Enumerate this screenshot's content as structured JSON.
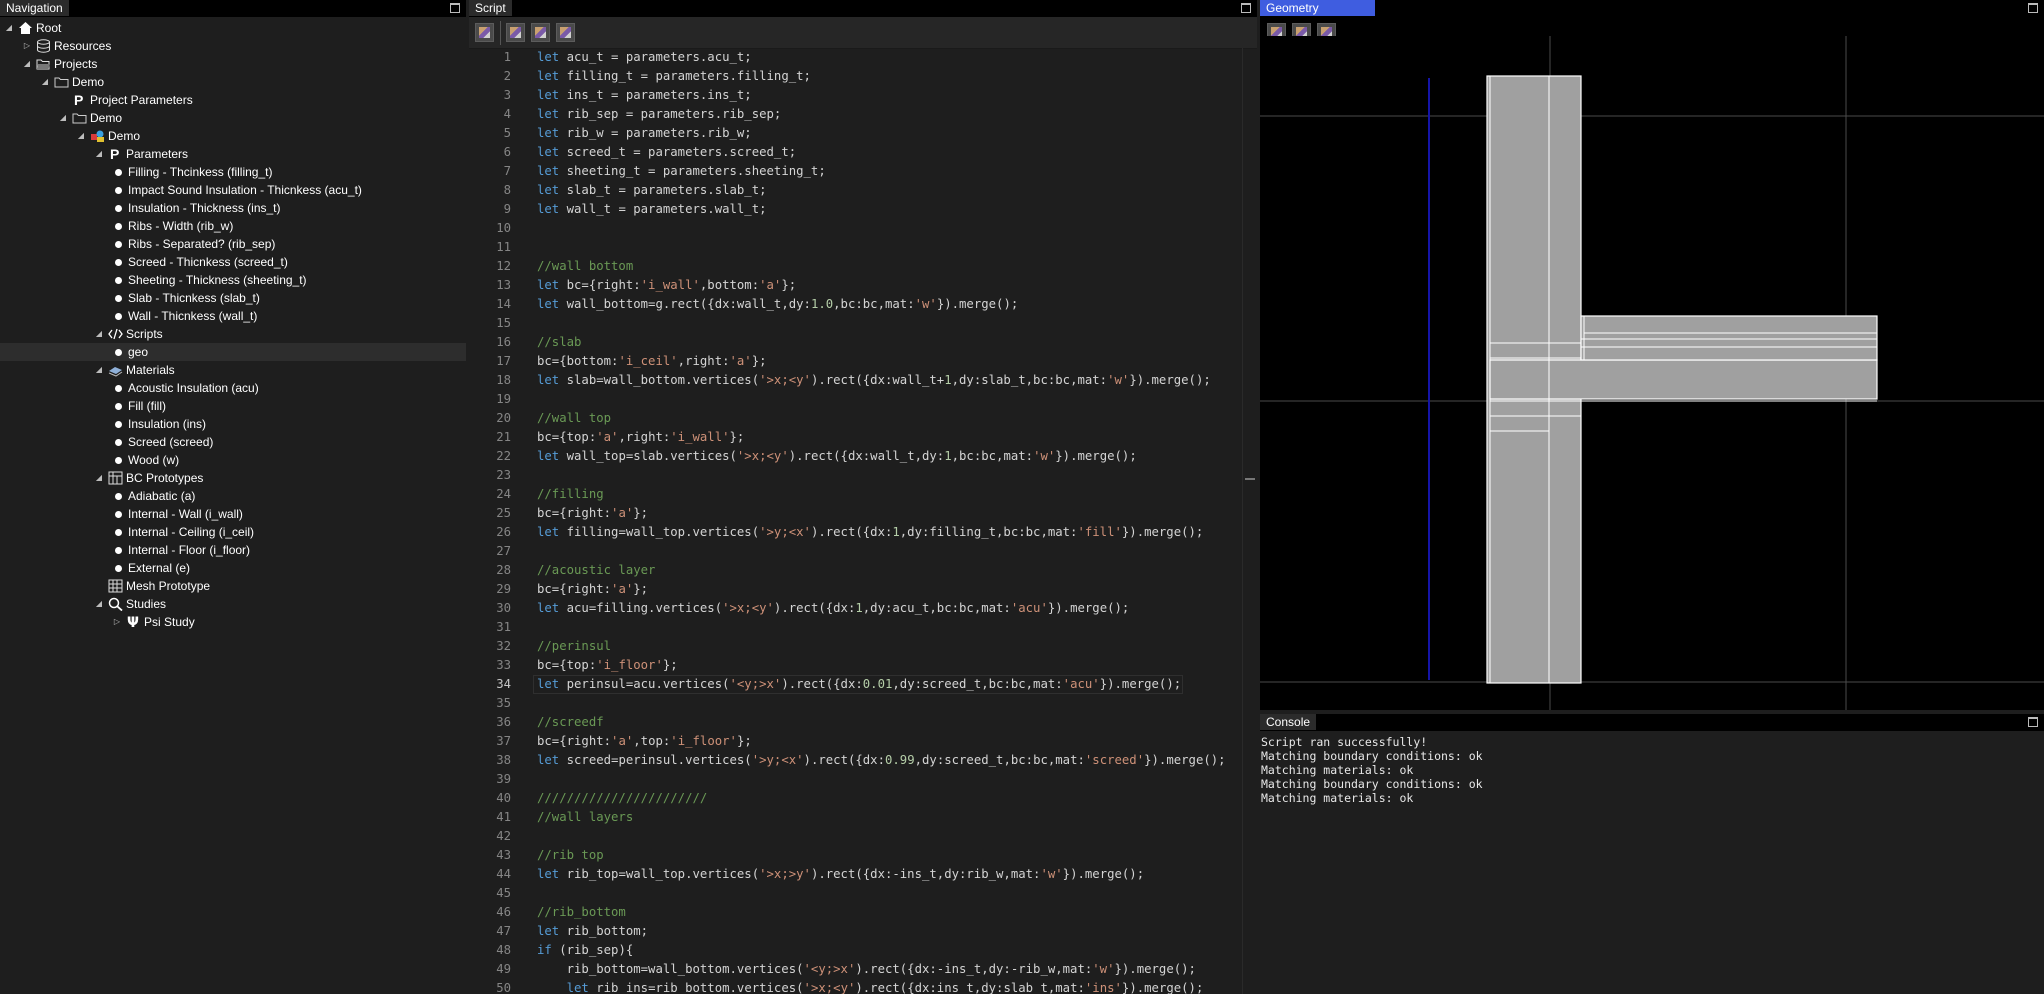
{
  "nav": {
    "title": "Navigation",
    "items": [
      {
        "label": "Root",
        "icon": "home-icon",
        "toggle": "expanded",
        "depth": 0
      },
      {
        "label": "Resources",
        "icon": "database-icon",
        "toggle": "collapsed",
        "depth": 1
      },
      {
        "label": "Projects",
        "icon": "folder-open-icon",
        "toggle": "expanded",
        "depth": 1
      },
      {
        "label": "Demo",
        "icon": "folder-icon",
        "toggle": "expanded",
        "depth": 2
      },
      {
        "label": "Project Parameters",
        "icon": "parameter-icon",
        "toggle": "none",
        "depth": 3
      },
      {
        "label": "Demo",
        "icon": "folder-icon",
        "toggle": "expanded",
        "depth": 3
      },
      {
        "label": "Demo",
        "icon": "model-icon",
        "toggle": "expanded",
        "depth": 4
      },
      {
        "label": "Parameters",
        "icon": "parameter-icon",
        "toggle": "expanded",
        "depth": 5
      },
      {
        "label": "Filling - Thcinkess (filling_t)",
        "icon": "dot",
        "toggle": "none",
        "depth": 6
      },
      {
        "label": "Impact Sound Insulation - Thicnkess (acu_t)",
        "icon": "dot",
        "toggle": "none",
        "depth": 6
      },
      {
        "label": "Insulation - Thickness (ins_t)",
        "icon": "dot",
        "toggle": "none",
        "depth": 6
      },
      {
        "label": "Ribs - Width (rib_w)",
        "icon": "dot",
        "toggle": "none",
        "depth": 6
      },
      {
        "label": "Ribs - Separated? (rib_sep)",
        "icon": "dot",
        "toggle": "none",
        "depth": 6
      },
      {
        "label": "Screed - Thicnkess (screed_t)",
        "icon": "dot",
        "toggle": "none",
        "depth": 6
      },
      {
        "label": "Sheeting - Thickness (sheeting_t)",
        "icon": "dot",
        "toggle": "none",
        "depth": 6
      },
      {
        "label": "Slab - Thicnkess (slab_t)",
        "icon": "dot",
        "toggle": "none",
        "depth": 6
      },
      {
        "label": "Wall - Thicnkess (wall_t)",
        "icon": "dot",
        "toggle": "none",
        "depth": 6
      },
      {
        "label": "Scripts",
        "icon": "code-icon",
        "toggle": "expanded",
        "depth": 5
      },
      {
        "label": "geo",
        "icon": "dot",
        "toggle": "none",
        "depth": 6,
        "selected": true
      },
      {
        "label": "Materials",
        "icon": "materials-icon",
        "toggle": "expanded",
        "depth": 5
      },
      {
        "label": "Acoustic Insulation (acu)",
        "icon": "dot",
        "toggle": "none",
        "depth": 6
      },
      {
        "label": "Fill (fill)",
        "icon": "dot",
        "toggle": "none",
        "depth": 6
      },
      {
        "label": "Insulation (ins)",
        "icon": "dot",
        "toggle": "none",
        "depth": 6
      },
      {
        "label": "Screed (screed)",
        "icon": "dot",
        "toggle": "none",
        "depth": 6
      },
      {
        "label": "Wood (w)",
        "icon": "dot",
        "toggle": "none",
        "depth": 6
      },
      {
        "label": "BC Prototypes",
        "icon": "bc-icon",
        "toggle": "expanded",
        "depth": 5
      },
      {
        "label": "Adiabatic (a)",
        "icon": "dot",
        "toggle": "none",
        "depth": 6
      },
      {
        "label": "Internal - Wall (i_wall)",
        "icon": "dot",
        "toggle": "none",
        "depth": 6
      },
      {
        "label": "Internal - Ceiling (i_ceil)",
        "icon": "dot",
        "toggle": "none",
        "depth": 6
      },
      {
        "label": "Internal - Floor (i_floor)",
        "icon": "dot",
        "toggle": "none",
        "depth": 6
      },
      {
        "label": "External (e)",
        "icon": "dot",
        "toggle": "none",
        "depth": 6
      },
      {
        "label": "Mesh Prototype",
        "icon": "mesh-icon",
        "toggle": "none",
        "depth": 5
      },
      {
        "label": "Studies",
        "icon": "search-icon",
        "toggle": "expanded",
        "depth": 5
      },
      {
        "label": "Psi Study",
        "icon": "psi-icon",
        "toggle": "collapsed",
        "depth": 6
      }
    ]
  },
  "script": {
    "title": "Script",
    "current_line": 34,
    "lines": [
      "let acu_t = parameters.acu_t;",
      "let filling_t = parameters.filling_t;",
      "let ins_t = parameters.ins_t;",
      "let rib_sep = parameters.rib_sep;",
      "let rib_w = parameters.rib_w;",
      "let screed_t = parameters.screed_t;",
      "let sheeting_t = parameters.sheeting_t;",
      "let slab_t = parameters.slab_t;",
      "let wall_t = parameters.wall_t;",
      "",
      "",
      "//wall bottom",
      "let bc={right:'i_wall',bottom:'a'};",
      "let wall_bottom=g.rect({dx:wall_t,dy:1.0,bc:bc,mat:'w'}).merge();",
      "",
      "//slab",
      "bc={bottom:'i_ceil',right:'a'};",
      "let slab=wall_bottom.vertices('>x;<y').rect({dx:wall_t+1,dy:slab_t,bc:bc,mat:'w'}).merge();",
      "",
      "//wall top",
      "bc={top:'a',right:'i_wall'};",
      "let wall_top=slab.vertices('>x;<y').rect({dx:wall_t,dy:1,bc:bc,mat:'w'}).merge();",
      "",
      "//filling",
      "bc={right:'a'};",
      "let filling=wall_top.vertices('>y;<x').rect({dx:1,dy:filling_t,bc:bc,mat:'fill'}).merge();",
      "",
      "//acoustic layer",
      "bc={right:'a'};",
      "let acu=filling.vertices('>x;<y').rect({dx:1,dy:acu_t,bc:bc,mat:'acu'}).merge();",
      "",
      "//perinsul",
      "bc={top:'i_floor'};",
      "let perinsul=acu.vertices('<y;>x').rect({dx:0.01,dy:screed_t,bc:bc,mat:'acu'}).merge();",
      "",
      "//screedf",
      "bc={right:'a',top:'i_floor'};",
      "let screed=perinsul.vertices('>y;<x').rect({dx:0.99,dy:screed_t,bc:bc,mat:'screed'}).merge();",
      "",
      "///////////////////////",
      "//wall layers",
      "",
      "//rib top",
      "let rib_top=wall_top.vertices('>x;>y').rect({dx:-ins_t,dy:rib_w,mat:'w'}).merge();",
      "",
      "//rib_bottom",
      "let rib_bottom;",
      "if (rib_sep){",
      "    rib_bottom=wall_bottom.vertices('<y;>x').rect({dx:-ins_t,dy:-rib_w,mat:'w'}).merge();",
      "    let rib_ins=rib_bottom.vertices('>x;<y').rect({dx:ins_t,dy:slab_t,mat:'ins'}).merge();"
    ]
  },
  "geometry": {
    "title": "Geometry"
  },
  "console": {
    "title": "Console",
    "lines": [
      "Script ran successfully!",
      "Matching boundary conditions: ok",
      "Matching materials: ok",
      "Matching boundary conditions: ok",
      "Matching materials: ok"
    ]
  }
}
